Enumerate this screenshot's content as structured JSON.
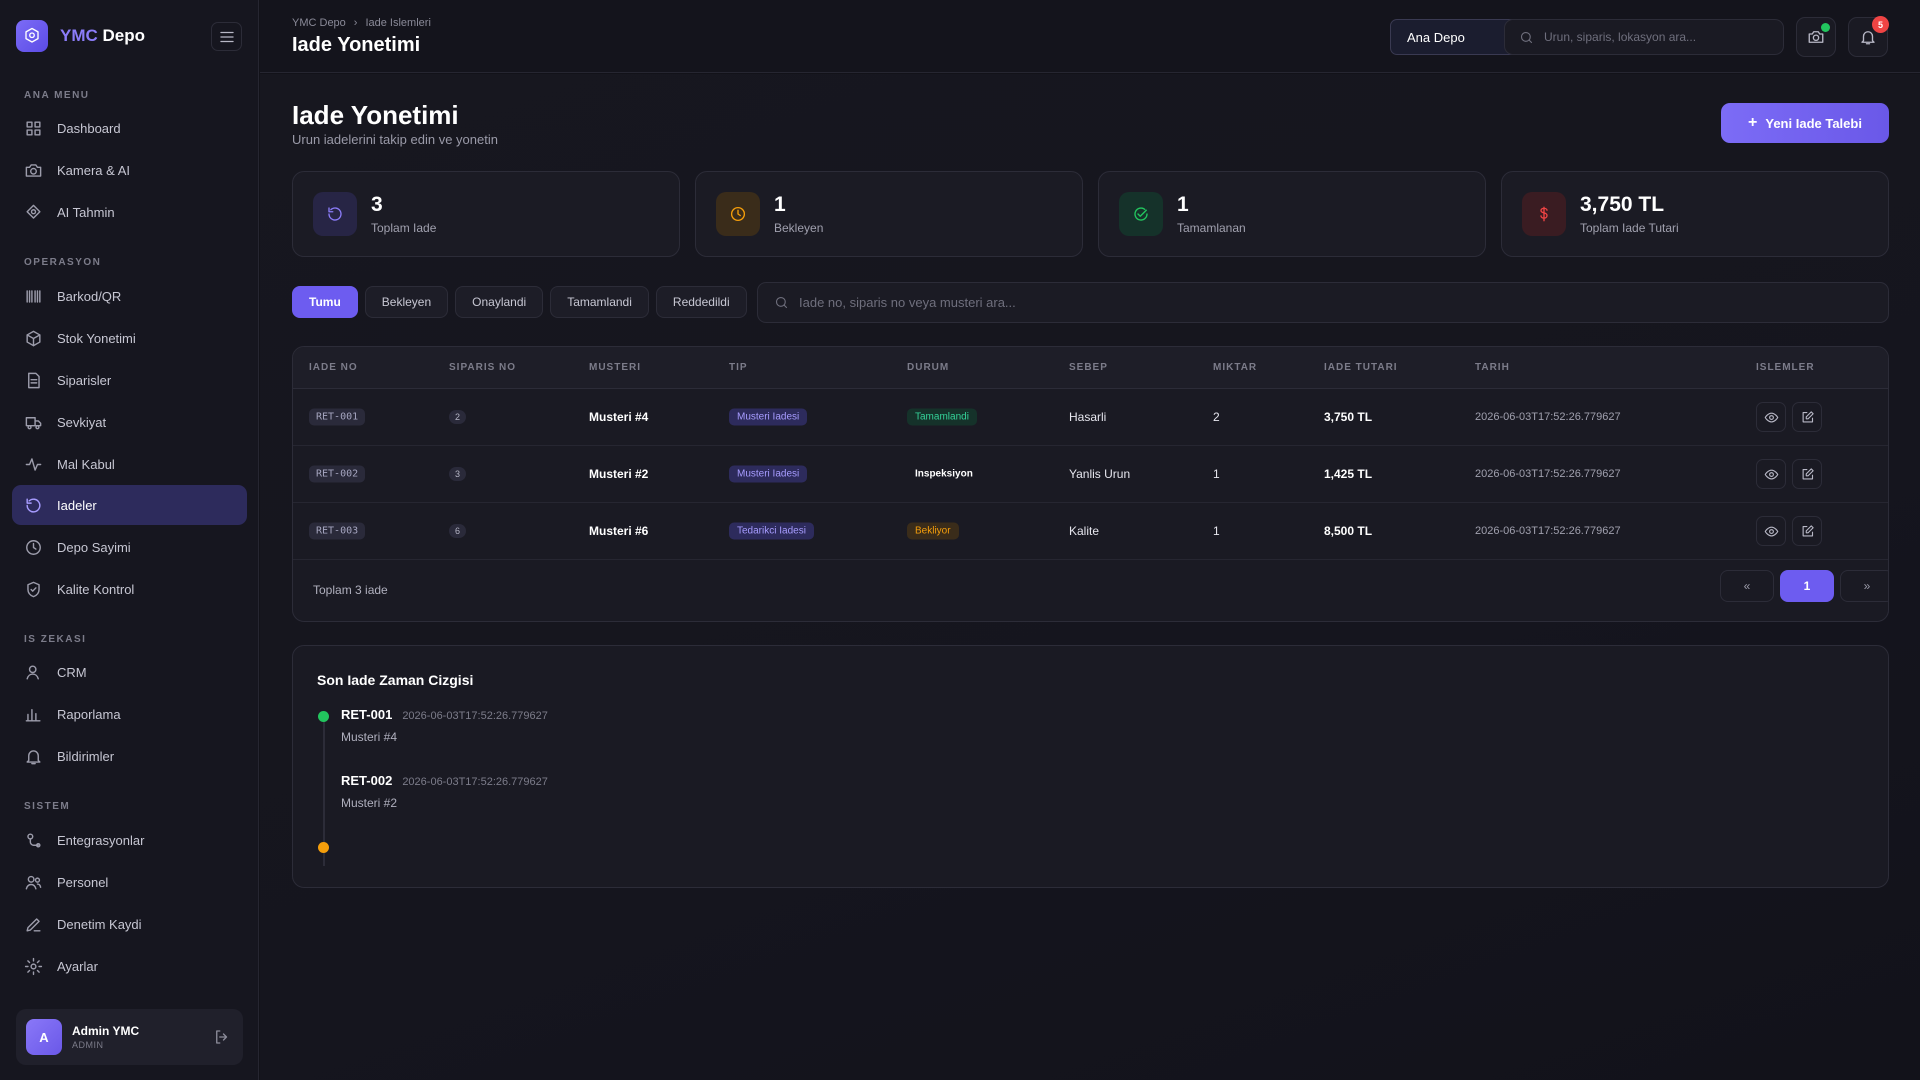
{
  "brand": {
    "accent": "YMC",
    "name": "Depo"
  },
  "sidebar": {
    "sections": [
      {
        "title": "ANA MENU",
        "items": [
          {
            "label": "Dashboard",
            "icon": "grid-icon"
          },
          {
            "label": "Kamera & AI",
            "icon": "camera-icon"
          },
          {
            "label": "AI Tahmin",
            "icon": "ai-icon"
          }
        ]
      },
      {
        "title": "OPERASYON",
        "items": [
          {
            "label": "Barkod/QR",
            "icon": "barcode-icon"
          },
          {
            "label": "Stok Yonetimi",
            "icon": "box-icon"
          },
          {
            "label": "Siparisler",
            "icon": "document-icon"
          },
          {
            "label": "Sevkiyat",
            "icon": "truck-icon"
          },
          {
            "label": "Mal Kabul",
            "icon": "activity-icon"
          },
          {
            "label": "Iadeler",
            "icon": "rotate-icon",
            "active": true
          },
          {
            "label": "Depo Sayimi",
            "icon": "clock-icon"
          },
          {
            "label": "Kalite Kontrol",
            "icon": "shield-icon"
          }
        ]
      },
      {
        "title": "IS ZEKASI",
        "items": [
          {
            "label": "CRM",
            "icon": "user-icon"
          },
          {
            "label": "Raporlama",
            "icon": "bar-chart-icon"
          },
          {
            "label": "Bildirimler",
            "icon": "bell-icon"
          }
        ]
      },
      {
        "title": "SISTEM",
        "items": [
          {
            "label": "Entegrasyonlar",
            "icon": "integration-icon"
          },
          {
            "label": "Personel",
            "icon": "users-icon"
          },
          {
            "label": "Denetim Kaydi",
            "icon": "pen-icon"
          },
          {
            "label": "Ayarlar",
            "icon": "gear-icon"
          }
        ]
      }
    ],
    "user": {
      "initial": "A",
      "name": "Admin YMC",
      "role": "ADMIN"
    }
  },
  "topbar": {
    "breadcrumb": [
      "YMC Depo",
      "Iade Islemleri"
    ],
    "title": "Iade Yonetimi",
    "depo_select": "Ana Depo",
    "search_placeholder": "Urun, siparis, lokasyon ara...",
    "notification_count": "5"
  },
  "page": {
    "title": "Iade Yonetimi",
    "subtitle": "Urun iadelerini takip edin ve yonetin",
    "new_button": "Yeni Iade Talebi"
  },
  "stats": [
    {
      "value": "3",
      "label": "Toplam Iade",
      "icon": "rotate-icon",
      "color": "#7c6cf6"
    },
    {
      "value": "1",
      "label": "Bekleyen",
      "icon": "clock-icon",
      "color": "#f59e0b"
    },
    {
      "value": "1",
      "label": "Tamamlanan",
      "icon": "check-circle-icon",
      "color": "#22c55e"
    },
    {
      "value": "3,750 TL",
      "label": "Toplam Iade Tutari",
      "icon": "dollar-icon",
      "color": "#ef4444"
    }
  ],
  "filters": {
    "tabs": [
      "Tumu",
      "Bekleyen",
      "Onaylandi",
      "Tamamlandi",
      "Reddedildi"
    ],
    "active": "Tumu",
    "search_placeholder": "Iade no, siparis no veya musteri ara..."
  },
  "table": {
    "headers": [
      "IADE NO",
      "SIPARIS NO",
      "MUSTERI",
      "TIP",
      "DURUM",
      "SEBEP",
      "MIKTAR",
      "IADE TUTARI",
      "TARIH",
      "ISLEMLER"
    ],
    "rows": [
      {
        "iade_no": "RET-001",
        "siparis_no": "2",
        "musteri": "Musteri #4",
        "tip": "Musteri Iadesi",
        "durum": "Tamamlandi",
        "sebep": "Hasarli",
        "miktar": "2",
        "tutar": "3,750 TL",
        "tarih": "2026-06-03T17:52:26.779627"
      },
      {
        "iade_no": "RET-002",
        "siparis_no": "3",
        "musteri": "Musteri #2",
        "tip": "Musteri Iadesi",
        "durum": "Inspeksiyon",
        "sebep": "Yanlis Urun",
        "miktar": "1",
        "tutar": "1,425 TL",
        "tarih": "2026-06-03T17:52:26.779627"
      },
      {
        "iade_no": "RET-003",
        "siparis_no": "6",
        "musteri": "Musteri #6",
        "tip": "Tedarikci Iadesi",
        "durum": "Bekliyor",
        "sebep": "Kalite",
        "miktar": "1",
        "tutar": "8,500 TL",
        "tarih": "2026-06-03T17:52:26.779627"
      }
    ],
    "footer": "Toplam 3 iade",
    "pagination": {
      "prev": "«",
      "current": "1",
      "next": "»"
    }
  },
  "timeline": {
    "title": "Son Iade Zaman Cizgisi",
    "items": [
      {
        "id": "RET-001",
        "date": "2026-06-03T17:52:26.779627",
        "customer": "Musteri #4"
      },
      {
        "id": "RET-002",
        "date": "2026-06-03T17:52:26.779627",
        "customer": "Musteri #2"
      }
    ]
  },
  "colors": {
    "accent": "#6d5cf0",
    "success": "#22c55e",
    "warning": "#f59e0b",
    "danger": "#ef4444"
  }
}
